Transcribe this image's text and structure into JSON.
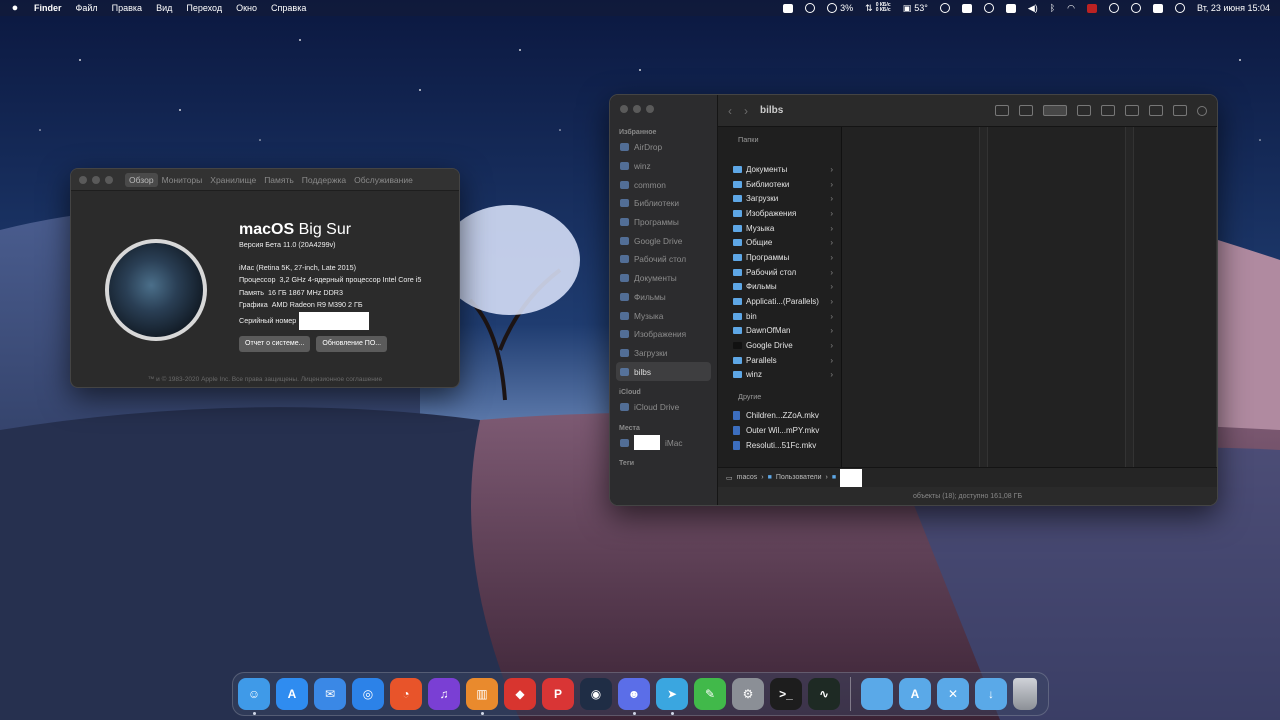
{
  "colors": {
    "menubar": "#1b2443",
    "folder": "#5ea7e6",
    "window_bg": "#1f1f1f"
  },
  "menubar": {
    "app": "Finder",
    "menus": [
      "Файл",
      "Правка",
      "Вид",
      "Переход",
      "Окно",
      "Справка"
    ],
    "battery_text": "3%",
    "net_up": "0 КБ/с",
    "net_down": "0 КБ/с",
    "temp": "53°",
    "datetime": "Вт, 23 июня  15:04"
  },
  "about": {
    "tabs": [
      "Обзор",
      "Мониторы",
      "Хранилище",
      "Память",
      "Поддержка",
      "Обслуживание"
    ],
    "os_bold": "macOS",
    "os_rest": "Big Sur",
    "version": "Версия Бета 11.0 (20A4299v)",
    "model": "iMac (Retina 5K, 27-inch, Late 2015)",
    "cpu_label": "Процессор",
    "cpu_value": "3,2 GHz 4-ядерный процессор Intel Core i5",
    "mem_label": "Память",
    "mem_value": "16 ГБ 1867 MHz DDR3",
    "gpu_label": "Графика",
    "gpu_value": "AMD Radeon R9 M390 2 ГБ",
    "serial_label": "Серийный номер",
    "btn_report": "Отчет о системе...",
    "btn_update": "Обновление ПО...",
    "footer": "™ и © 1983-2020 Apple Inc. Все права защищены. Лицензионное соглашение"
  },
  "finder": {
    "title": "bilbs",
    "sidebar": {
      "favorites_head": "Избранное",
      "favorites": [
        "AirDrop",
        "winz",
        "common",
        "Библиотеки",
        "Программы",
        "Google Drive",
        "Рабочий стол",
        "Документы",
        "Фильмы",
        "Музыка",
        "Изображения",
        "Загрузки",
        "bilbs"
      ],
      "icloud_head": "iCloud",
      "icloud": [
        "iCloud Drive"
      ],
      "places_head": "Места",
      "places_item": "iMac",
      "tags_head": "Теги"
    },
    "folders_head": "Папки",
    "folders": [
      "Документы",
      "Библиотеки",
      "Загрузки",
      "Изображения",
      "Музыка",
      "Общие",
      "Программы",
      "Рабочий стол",
      "Фильмы",
      "Applicati...(Parallels)",
      "bin",
      "DawnOfMan",
      "Google Drive",
      "Parallels",
      "winz"
    ],
    "others_head": "Другие",
    "others": [
      "Children...ZZoA.mkv",
      "Outer Wil...mPY.mkv",
      "Resoluti...51Fc.mkv"
    ],
    "path": [
      "macos",
      "Пользователи"
    ],
    "status": "объекты (18); доступно 161,08 ГБ"
  },
  "dock": {
    "icons": [
      {
        "name": "finder-icon",
        "color": "#3f9ae8",
        "glyph": "☺"
      },
      {
        "name": "app-store-icon",
        "color": "#2f8cf0",
        "glyph": "A"
      },
      {
        "name": "mail-icon",
        "color": "#3a88e6",
        "glyph": "✉"
      },
      {
        "name": "safari-icon",
        "color": "#2c82e8",
        "glyph": "◎"
      },
      {
        "name": "rss-icon",
        "color": "#e8542a",
        "glyph": "◔"
      },
      {
        "name": "music-icon",
        "color": "#7a3fd4",
        "glyph": "♫"
      },
      {
        "name": "radio-icon",
        "color": "#e98a2d",
        "glyph": "▥"
      },
      {
        "name": "red-box-icon",
        "color": "#d8352f",
        "glyph": "◆"
      },
      {
        "name": "pinterest-icon",
        "color": "#d93535",
        "glyph": "P"
      },
      {
        "name": "steam-icon",
        "color": "#1f2d45",
        "glyph": "◉"
      },
      {
        "name": "discord-icon",
        "color": "#5b6ee8",
        "glyph": "☻"
      },
      {
        "name": "telegram-icon",
        "color": "#3aa6e0",
        "glyph": "➤"
      },
      {
        "name": "messages-icon",
        "color": "#41b94a",
        "glyph": "✎"
      },
      {
        "name": "system-preferences-icon",
        "color": "#8b8f96",
        "glyph": "⚙"
      },
      {
        "name": "terminal-icon",
        "color": "#1d1d1d",
        "glyph": ">_"
      },
      {
        "name": "activity-monitor-icon",
        "color": "#1e2a24",
        "glyph": "∿"
      }
    ],
    "folders": [
      {
        "name": "folder-stack-icon",
        "color": "#5aa9e8",
        "glyph": ""
      },
      {
        "name": "applications-folder-icon",
        "color": "#5aa9e8",
        "glyph": "A"
      },
      {
        "name": "utilities-folder-icon",
        "color": "#5aa9e8",
        "glyph": "✕"
      },
      {
        "name": "downloads-folder-icon",
        "color": "#5aa9e8",
        "glyph": "↓"
      }
    ]
  }
}
